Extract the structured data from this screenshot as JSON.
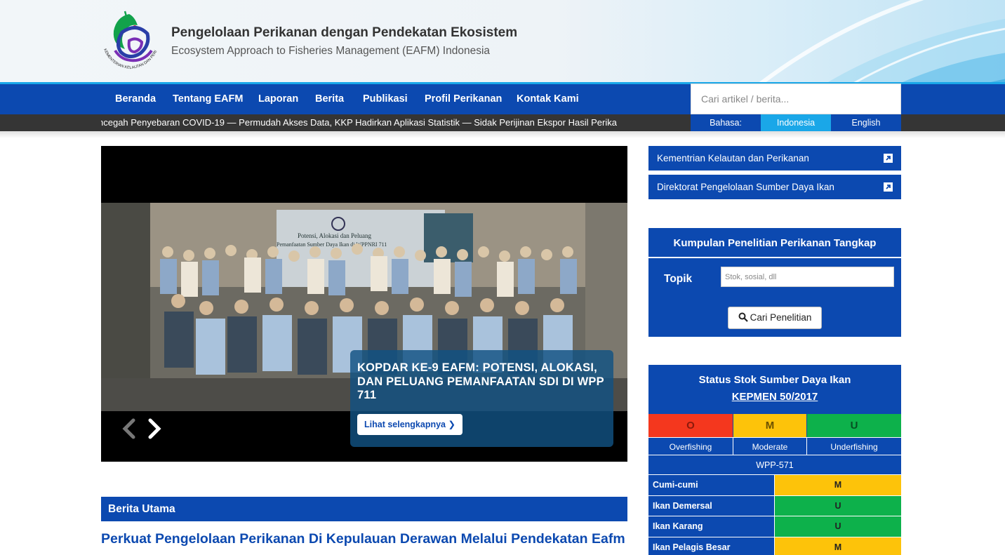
{
  "header": {
    "title": "Pengelolaan Perikanan dengan Pendekatan Ekosistem",
    "subtitle": "Ecosystem Approach to Fisheries Management (EAFM) Indonesia",
    "logo_text": "KEMENTERIAN KELAUTAN DAN PERIKANAN"
  },
  "nav": {
    "items": [
      "Beranda",
      "Tentang EAFM",
      "Laporan",
      "Berita",
      "Publikasi",
      "Profil Perikanan",
      "Kontak Kami"
    ],
    "search_placeholder": "Cari artikel / berita..."
  },
  "ticker": {
    "text": "ncegah Penyebaran COVID-19  —  Permudah Akses Data, KKP Hadirkan Aplikasi Statistik  —  Sidak Perijinan Ekspor Hasil Perika"
  },
  "language": {
    "label": "Bahasa:",
    "options": [
      "Indonesia",
      "English"
    ],
    "selected": "Indonesia"
  },
  "slider": {
    "caption": "KOPDAR KE-9 EAFM: POTENSI, ALOKASI, DAN PELUANG PEMANFAATAN SDI DI WPP 711",
    "button": "Lihat selengkapnya",
    "banner_line1": "Potensi, Alokasi dan Peluang",
    "banner_line2": "Pemanfaatan Sumber Daya Ikan di WPPNRI 711"
  },
  "berita": {
    "section_title": "Berita Utama",
    "headline": "Perkuat Pengelolaan Perikanan Di Kepulauan Derawan Melalui Pendekatan Eafm"
  },
  "links": [
    {
      "label": "Kementrian Kelautan dan Perikanan"
    },
    {
      "label": "Direktorat Pengelolaan Sumber Daya Ikan"
    }
  ],
  "research": {
    "title": "Kumpulan Penelitian Perikanan Tangkap",
    "topic_label": "Topik",
    "topic_placeholder": "Stok, sosial, dll",
    "button": "Cari Penelitian"
  },
  "stok": {
    "title": "Status Stok Sumber Daya Ikan",
    "link": "KEPMEN 50/2017",
    "legend": [
      {
        "code": "O",
        "label": "Overfishing",
        "color": "#f4371e"
      },
      {
        "code": "M",
        "label": "Moderate",
        "color": "#fdc30a"
      },
      {
        "code": "U",
        "label": "Underfishing",
        "color": "#0db14b"
      }
    ],
    "wpp": "WPP-571",
    "rows": [
      {
        "name": "Cumi-cumi",
        "status": "M"
      },
      {
        "name": "Ikan Demersal",
        "status": "U"
      },
      {
        "name": "Ikan Karang",
        "status": "U"
      },
      {
        "name": "Ikan Pelagis Besar",
        "status": "M"
      }
    ]
  },
  "colors": {
    "primary": "#0c49b0",
    "accent": "#1aa7e8",
    "ticker_bg": "#353535"
  }
}
